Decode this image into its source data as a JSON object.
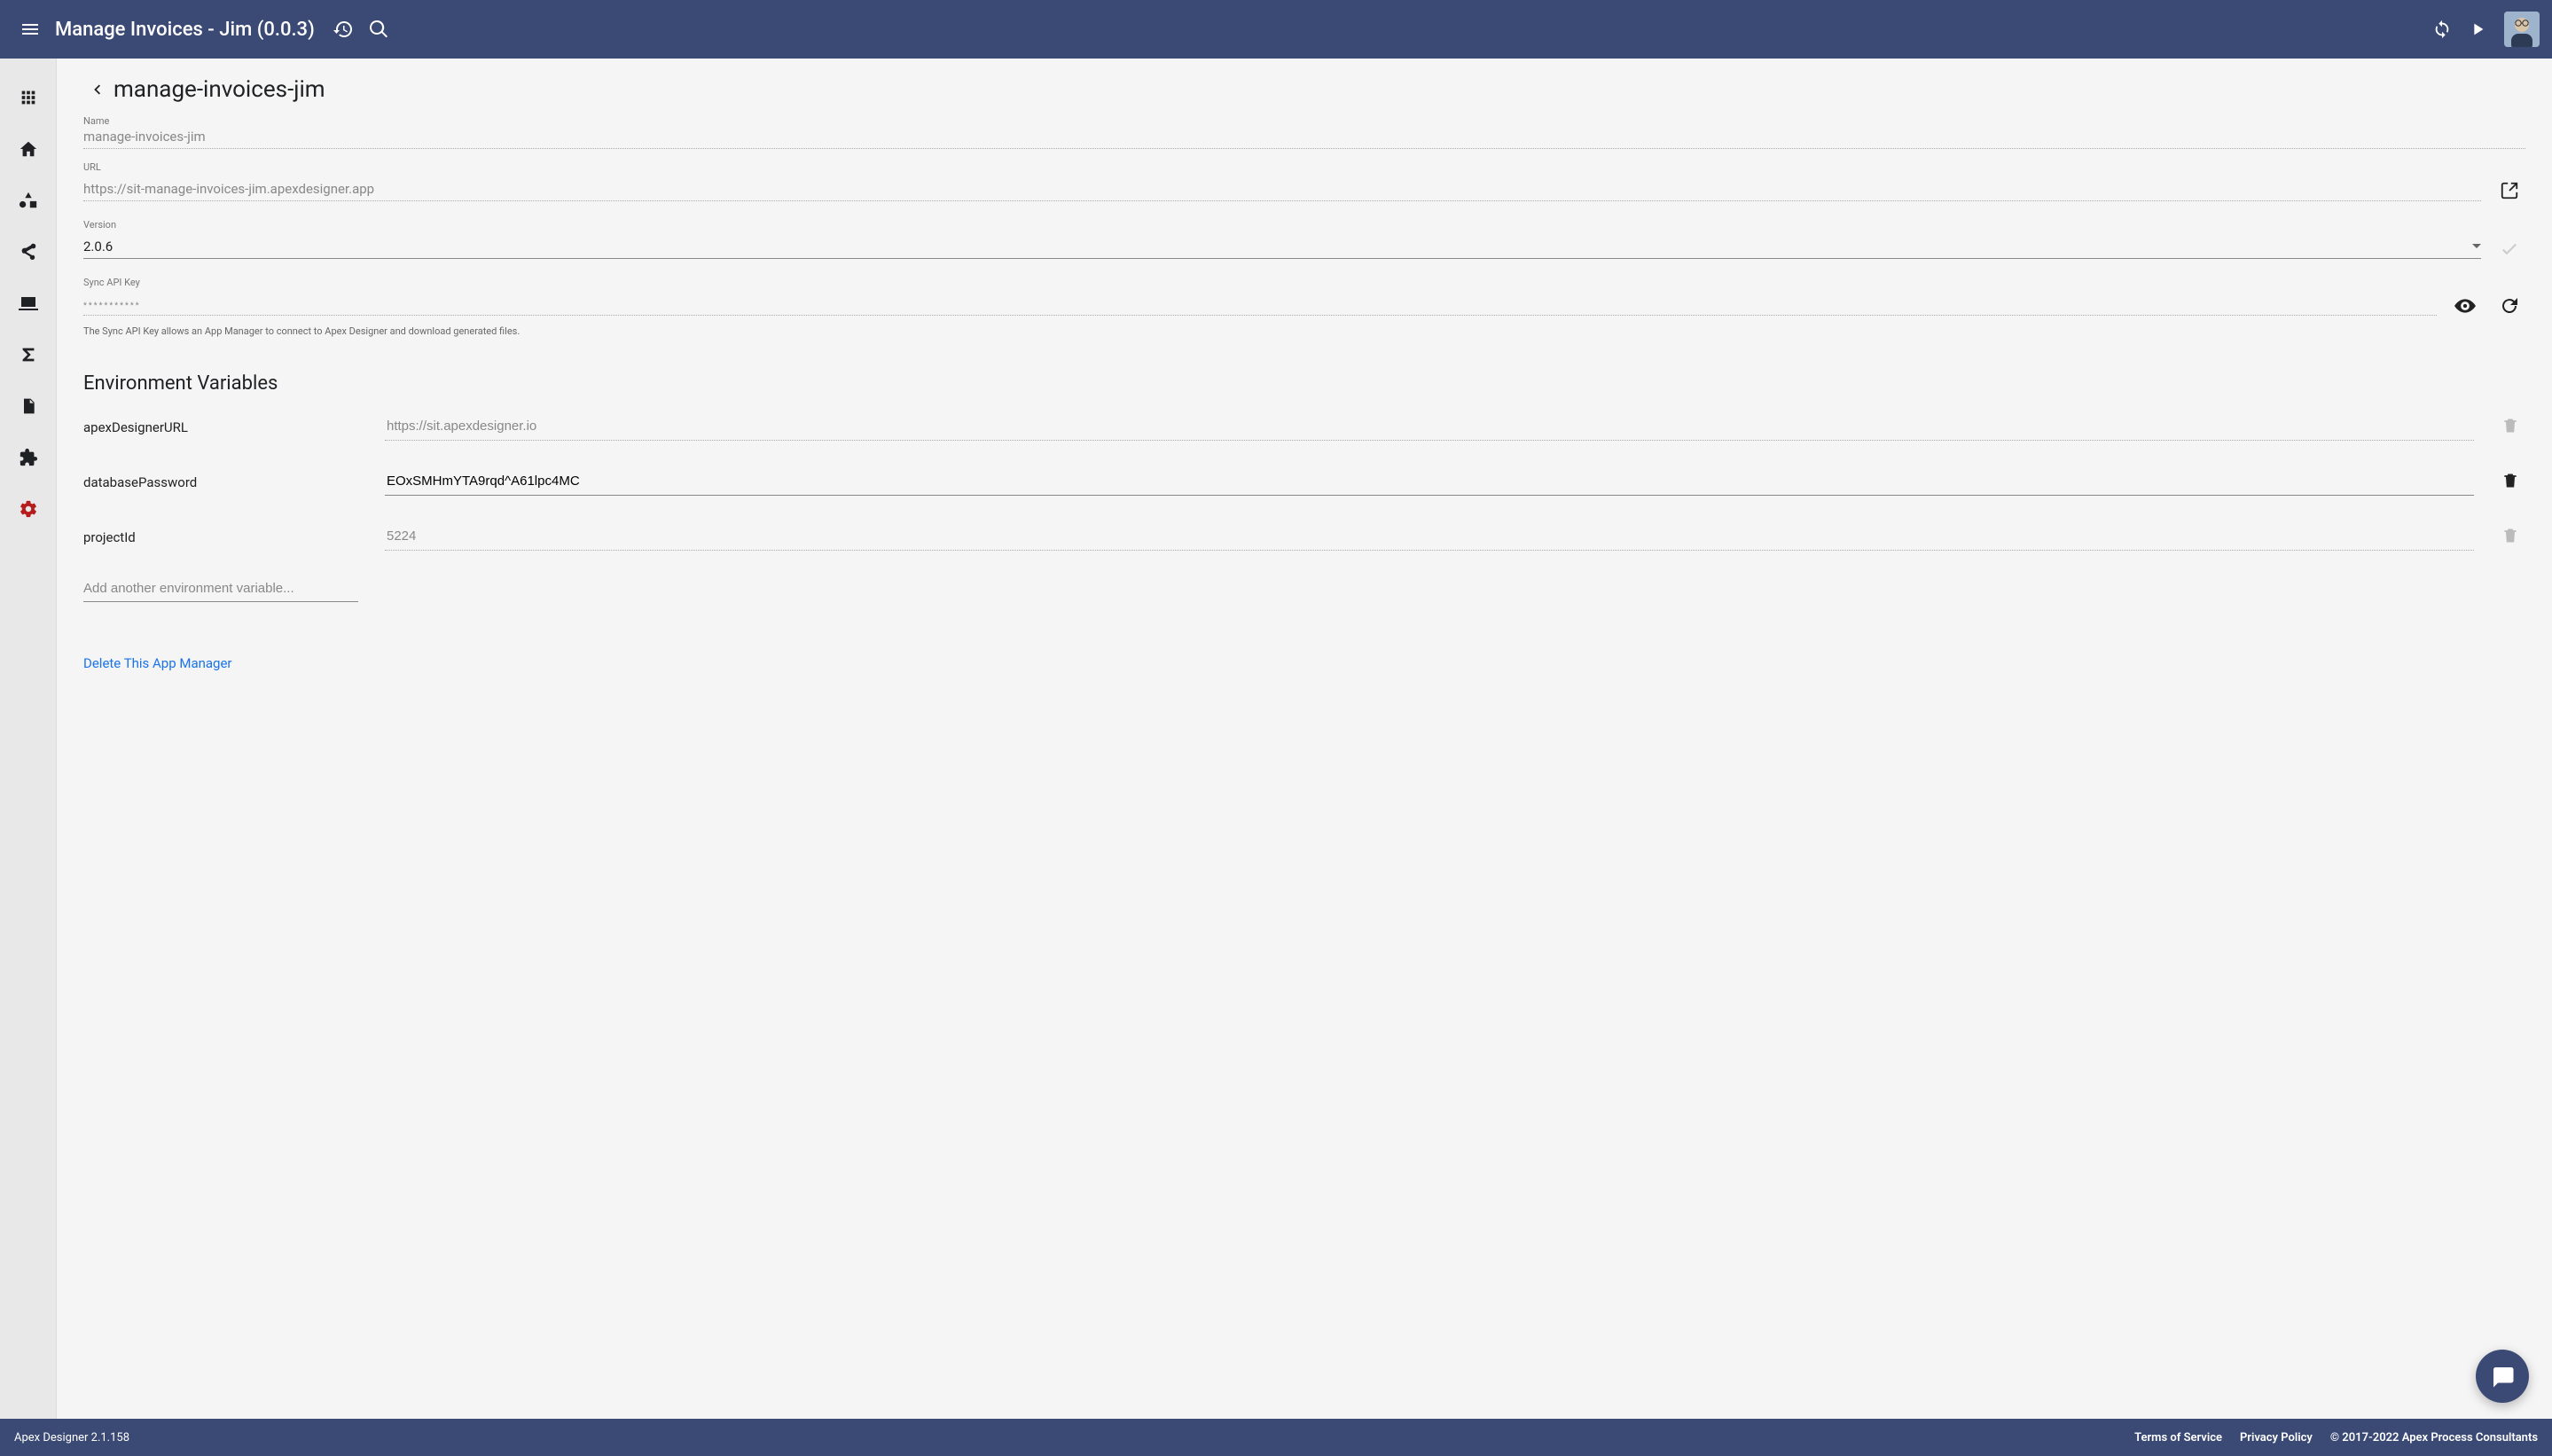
{
  "appbar": {
    "title": "Manage Invoices - Jim (0.0.3)"
  },
  "page": {
    "title": "manage-invoices-jim"
  },
  "fields": {
    "name": {
      "label": "Name",
      "value": "manage-invoices-jim"
    },
    "url": {
      "label": "URL",
      "value": "https://sit-manage-invoices-jim.apexdesigner.app"
    },
    "version": {
      "label": "Version",
      "value": "2.0.6"
    },
    "syncKey": {
      "label": "Sync API Key",
      "value": "***********",
      "hint": "The Sync API Key allows an App Manager to connect to Apex Designer and download generated files."
    }
  },
  "envSection": {
    "header": "Environment Variables",
    "addPlaceholder": "Add another environment variable...",
    "vars": [
      {
        "key": "apexDesignerURL",
        "value": "https://sit.apexdesigner.io",
        "readonly": true
      },
      {
        "key": "databasePassword",
        "value": "EOxSMHmYTA9rqd^A61lpc4MC",
        "readonly": false
      },
      {
        "key": "projectId",
        "value": "5224",
        "readonly": true
      }
    ]
  },
  "deleteLink": "Delete This App Manager",
  "footer": {
    "product": "Apex Designer 2.1.158",
    "tos": "Terms of Service",
    "privacy": "Privacy Policy",
    "copyright": "© 2017-2022 Apex Process Consultants"
  }
}
